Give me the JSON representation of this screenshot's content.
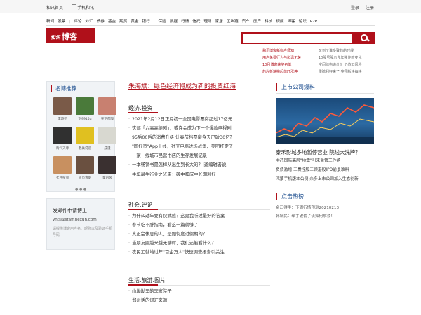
{
  "topbar": {
    "home": "和讯首页",
    "mobile": "手机和讯",
    "login": "登录",
    "register": "注册"
  },
  "nav": [
    "新闻",
    "股票",
    "评论",
    "外汇",
    "债券",
    "基金",
    "期货",
    "黄金",
    "银行",
    "保险",
    "数据",
    "行情",
    "信托",
    "理财",
    "家居",
    "区块链",
    "汽车",
    "房产",
    "科技",
    "视频",
    "博客",
    "论坛",
    "P2P"
  ],
  "logo": {
    "small": "和讯",
    "big": "博客"
  },
  "search": {
    "placeholder": ""
  },
  "hot": [
    [
      "和讯博客新帐户须知",
      "又到了谁多致的的时候"
    ],
    [
      "用户免费行为与和讯无关",
      "10股号股示今年赌作新变化"
    ],
    [
      "10月博客获奖名单",
      "空间结构追价价 仍依旧风险"
    ],
    [
      "芯片板块挑起体旺涨停",
      "重磅利好来了 突围板块每块"
    ]
  ],
  "famous": {
    "title": "名博推荐",
    "people": [
      {
        "name": "李晓迅",
        "color": "#7a5a48"
      },
      {
        "name": "刘9915a",
        "color": "#4a7a3a"
      },
      {
        "name": "天下都我",
        "color": "#c88070"
      },
      {
        "name": "淘气天尊",
        "color": "#303030"
      },
      {
        "name": "老兵说道",
        "color": "#e0c020"
      },
      {
        "name": "成漫",
        "color": "#d8d8d0"
      },
      {
        "name": "七月投资",
        "color": "#c89060"
      },
      {
        "name": "货币青影",
        "color": "#6a5040"
      },
      {
        "name": "童的风",
        "color": "#3a3030"
      }
    ],
    "dots": "● ● ●"
  },
  "mail": {
    "title": "发邮件申请博主",
    "email": "yhts@staff.hexun.com",
    "desc": "请提供博客用户名、昵称以及验证手机号码"
  },
  "headline": "朱海斌：绿色经济将成为新的投资红海",
  "sections": [
    {
      "title": "经济.投资",
      "items": [
        "2021年2月12日正月初一全国电影票房超过17亿元",
        "这部「六高高能剧」，或许会成为下一个爆款电视剧",
        "95后00后的消费升级 让春节档票房今天已破30亿？",
        "\"国好货\"App上线，社交电商进场战争，美团打定了",
        "一家一线城市民营书店的生存发展记录",
        "一本畅销书是怎样从出生到长大的？|邀编辑者说",
        "牛年最牛行业之光来：碳中和成中长期利好"
      ]
    },
    {
      "title": "社会.评论",
      "items": [
        "为什么过年要有仪式感？这是我听过最好的答案",
        "春节吃不胖指南，看这一篇就够了",
        "真正会休息的人，是如何度过假期的？",
        "当朋友圈越来越无聊时，我们还能看什么？",
        "农民工就地过年\"百企万人\"快速调查报告引关注"
      ]
    },
    {
      "title": "生活.旅游.图片",
      "items": [
        "山坳坳里的李家院子",
        "郑州话的词汇来源"
      ]
    }
  ],
  "right": {
    "title1": "上市公司爆料",
    "bold": "泰禾影城多地暂停营业 院线大洗牌？",
    "list1": [
      "中芯国际高层\"地震\"引来监管工作函",
      "负债激增 三贯控股三顾港股IPO前景难料",
      "鸿蒙手机版本公测 众多上市公司加入生态创新"
    ],
    "title2": "点击热榜",
    "list2": [
      "金汇得手：下周行情预测20210213",
      "韩毓民：牵手破套了该如何解套！"
    ]
  }
}
